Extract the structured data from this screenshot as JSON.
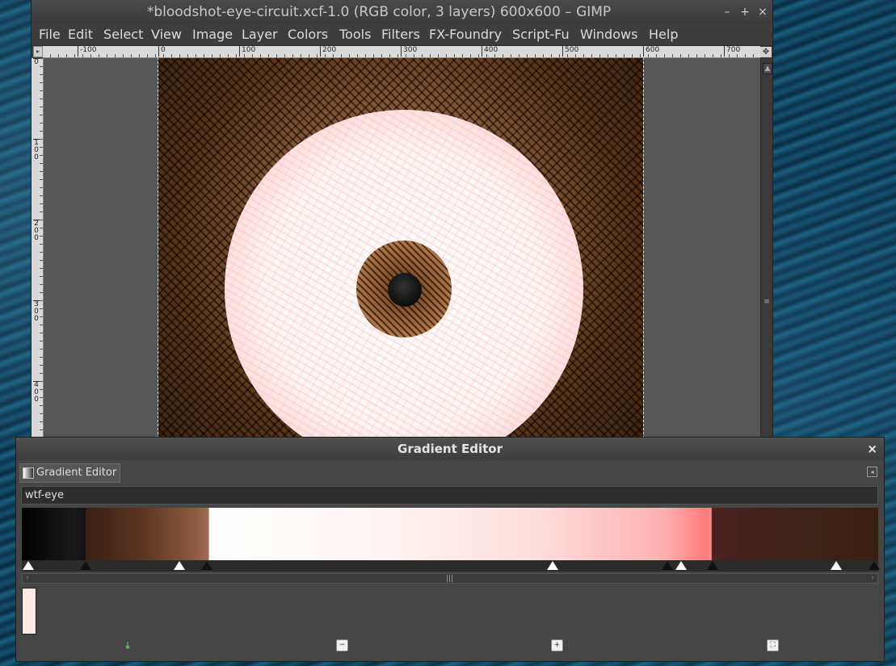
{
  "window": {
    "title": "*bloodshot-eye-circuit.xcf-1.0 (RGB color, 3 layers) 600x600 – GIMP",
    "minimize": "–",
    "maximize": "+",
    "close": "×"
  },
  "menubar": [
    "File",
    "Edit",
    "Select",
    "View",
    "Image",
    "Layer",
    "Colors",
    "Tools",
    "Filters",
    "FX-Foundry",
    "Script-Fu",
    "Windows",
    "Help"
  ],
  "hruler_labels": [
    "-100",
    "0",
    "100",
    "200",
    "300",
    "400",
    "500",
    "600",
    "700"
  ],
  "vruler_labels": [
    "0",
    "100",
    "200",
    "300",
    "400"
  ],
  "gradient_editor": {
    "title": "Gradient Editor",
    "close": "×",
    "tab_label": "Gradient Editor",
    "gradient_name": "wtf-eye"
  },
  "colors": {
    "ui_dark": "#3c3c3c",
    "canvas_bg": "#565656",
    "accent_red": "#ff7a7a"
  },
  "icons": {
    "save": "download-icon",
    "revert": "minus-icon",
    "zoom_in": "zoom-in-icon",
    "zoom_all": "zoom-fit-icon"
  }
}
